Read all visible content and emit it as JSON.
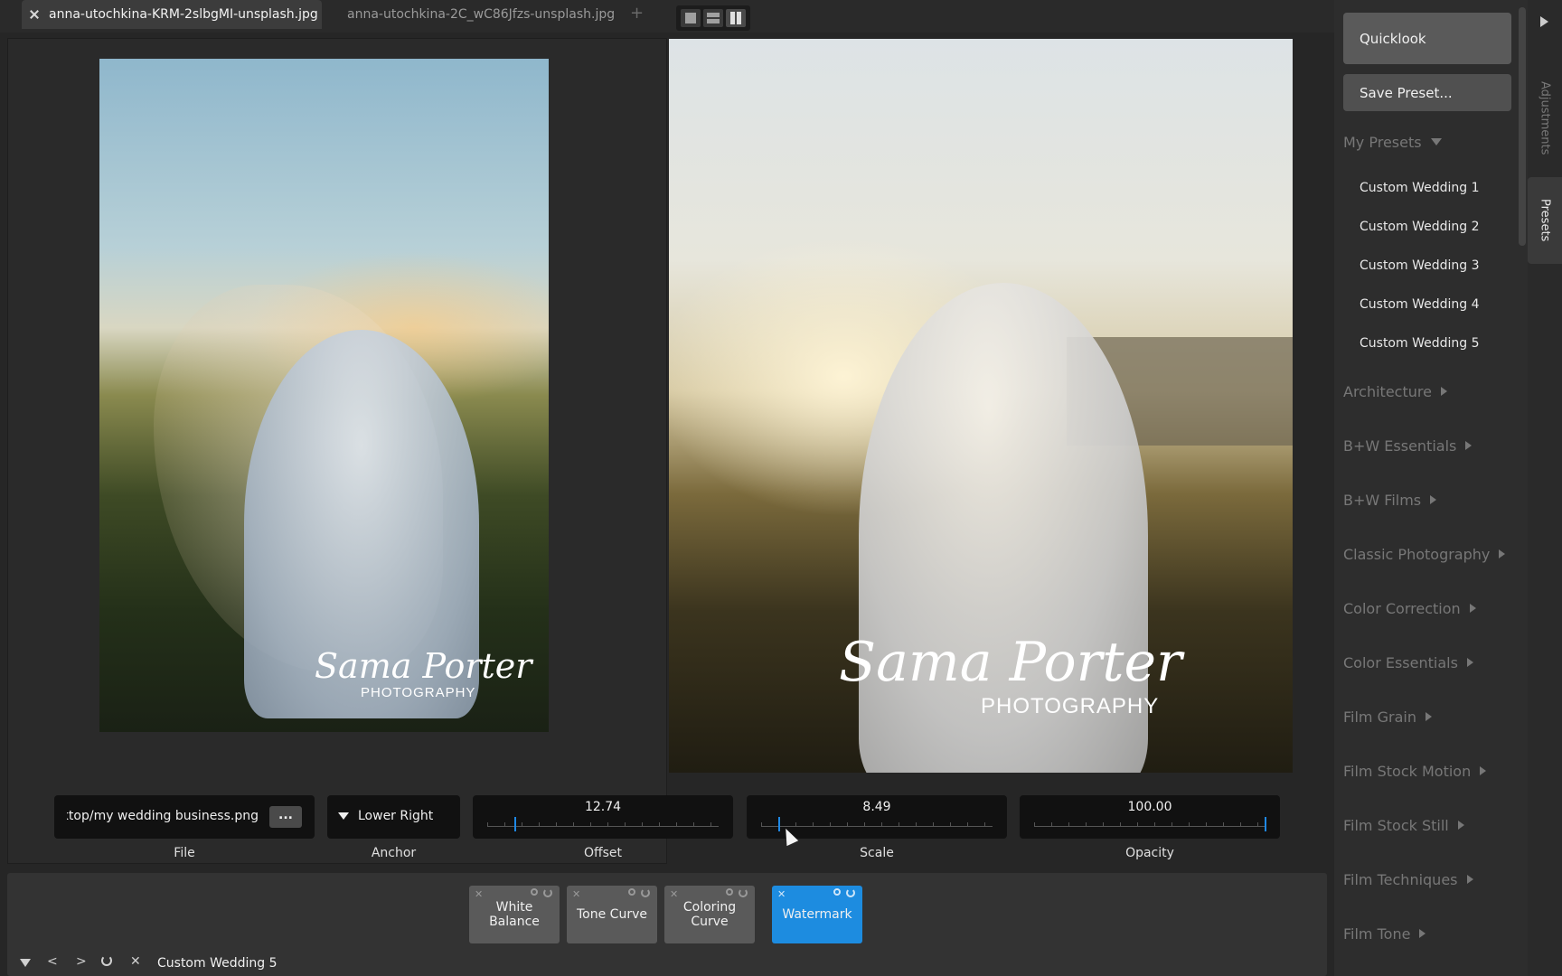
{
  "tabs": [
    {
      "label": "anna-utochkina-KRM-2slbgMI-unsplash.jpg",
      "active": true
    },
    {
      "label": "anna-utochkina-2C_wC86Jfzs-unsplash.jpg",
      "active": false
    }
  ],
  "tab_add": "+",
  "watermark_preview": {
    "script": "Sama Porter",
    "sub": "PHOTOGRAPHY"
  },
  "watermark_controls": {
    "file": {
      "value": "esktop/my wedding business.png",
      "button": "...",
      "label": "File"
    },
    "anchor": {
      "value": "Lower Right",
      "label": "Anchor"
    },
    "offset": {
      "value": "12.74",
      "label": "Offset",
      "fraction": 0.12
    },
    "scale": {
      "value": "8.49",
      "label": "Scale",
      "fraction": 0.08
    },
    "opacity": {
      "value": "100.00",
      "label": "Opacity",
      "fraction": 1.0
    }
  },
  "tool_chips": [
    {
      "line1": "White",
      "line2": "Balance",
      "active": false
    },
    {
      "line1": "Tone Curve",
      "line2": "",
      "active": false
    },
    {
      "line1": "Coloring",
      "line2": "Curve",
      "active": false
    },
    {
      "line1": "Watermark",
      "line2": "",
      "active": true
    }
  ],
  "nav": {
    "prev": "<",
    "next": ">",
    "close": "✕",
    "current_preset": "Custom Wedding 5"
  },
  "right_panel": {
    "quicklook": "Quicklook",
    "save_preset": "Save Preset...",
    "my_presets": "My Presets",
    "presets": [
      "Custom Wedding 1",
      "Custom Wedding 2",
      "Custom Wedding 3",
      "Custom Wedding 4",
      "Custom Wedding 5"
    ],
    "categories": [
      "Architecture",
      "B+W Essentials",
      "B+W Films",
      "Classic Photography",
      "Color Correction",
      "Color Essentials",
      "Film Grain",
      "Film Stock Motion",
      "Film Stock Still",
      "Film Techniques",
      "Film Tone"
    ]
  },
  "side_tabs": {
    "adjustments": "Adjustments",
    "presets": "Presets"
  },
  "colors": {
    "accent": "#1d8ce0",
    "panel": "#2d2d2d",
    "background": "#262626"
  }
}
